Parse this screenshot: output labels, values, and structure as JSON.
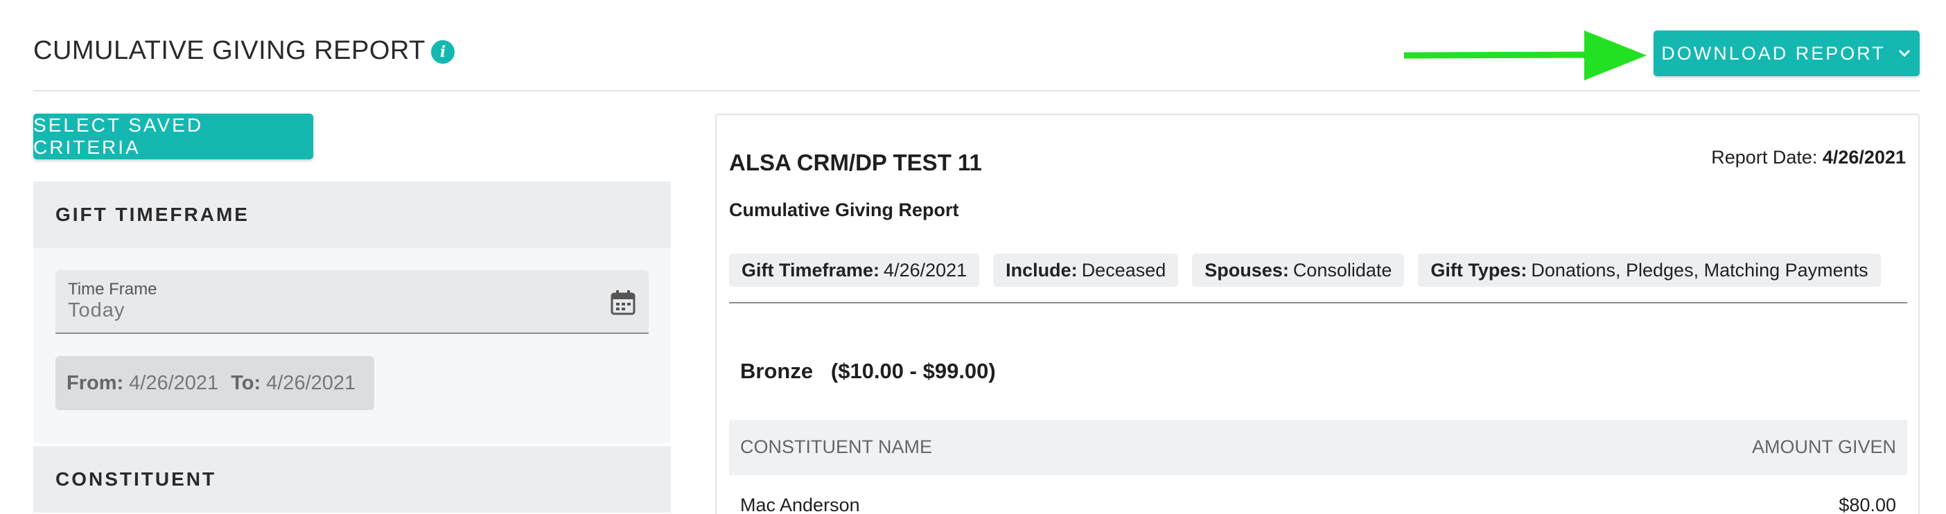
{
  "header": {
    "title": "CUMULATIVE GIVING REPORT",
    "info_icon": "info-icon",
    "download_label": "DOWNLOAD REPORT",
    "arrow_color": "#22e022",
    "accent_color": "#14b8b1"
  },
  "left_panel": {
    "saved_criteria_label": "SELECT SAVED CRITERIA",
    "sections": [
      {
        "title": "GIFT TIMEFRAME"
      },
      {
        "title": "CONSTITUENT"
      }
    ],
    "time_frame": {
      "label": "Time Frame",
      "value": "Today"
    },
    "range": {
      "from_label": "From:",
      "from_value": "4/26/2021",
      "to_label": "To:",
      "to_value": "4/26/2021"
    }
  },
  "report": {
    "org_name": "ALSA CRM/DP TEST 11",
    "report_date_label": "Report Date:",
    "report_date_value": "4/26/2021",
    "subtitle": "Cumulative Giving Report",
    "criteria": [
      {
        "label": "Gift Timeframe:",
        "value": "4/26/2021"
      },
      {
        "label": "Include:",
        "value": "Deceased"
      },
      {
        "label": "Spouses:",
        "value": "Consolidate"
      },
      {
        "label": "Gift Types:",
        "value": "Donations, Pledges, Matching Payments"
      }
    ],
    "tier": "Bronze   ($10.00 - $99.00)",
    "columns": [
      "CONSTITUENT NAME",
      "AMOUNT GIVEN"
    ],
    "rows": [
      {
        "name": "Mac Anderson",
        "amount": "$80.00"
      }
    ]
  }
}
